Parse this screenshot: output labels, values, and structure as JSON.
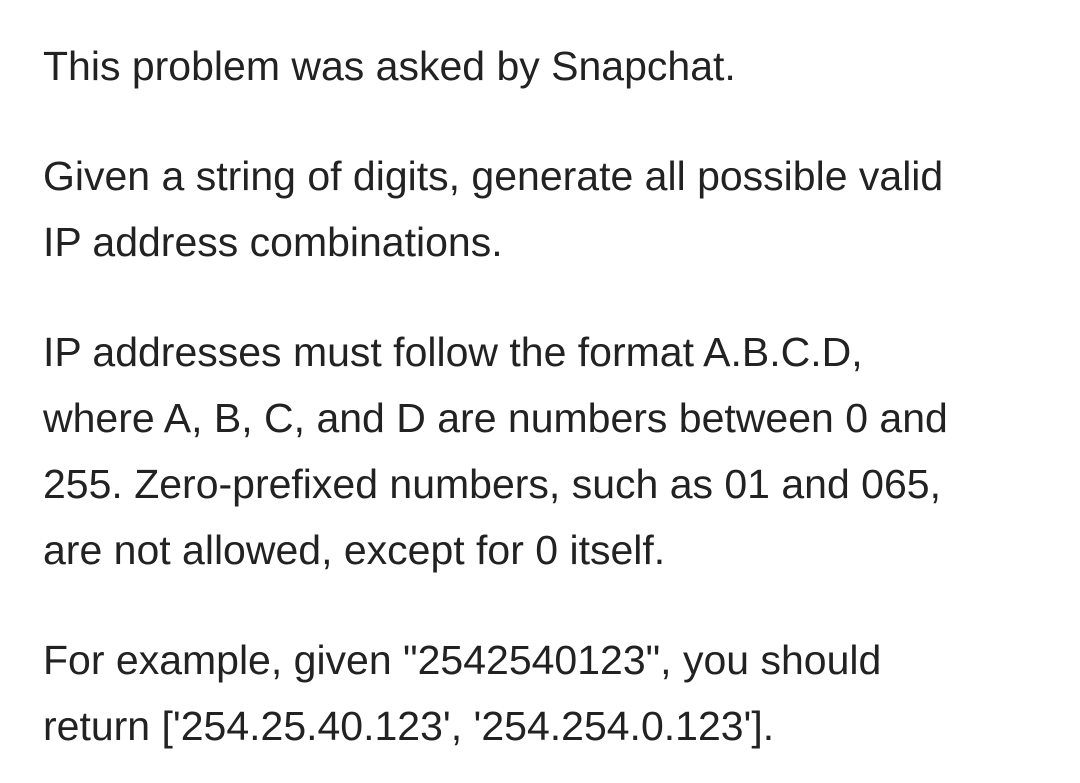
{
  "problem": {
    "intro": "This problem was asked by Snapchat.",
    "statement": "Given a string of digits, generate all possible valid\nIP address combinations.",
    "rules": "IP addresses must follow the format A.B.C.D,\nwhere A, B, C, and D are numbers between 0 and\n255. Zero-prefixed numbers, such as 01 and 065,\nare not allowed, except for 0 itself.",
    "example": "For example, given \"2542540123\", you should\nreturn ['254.25.40.123', '254.254.0.123']."
  }
}
